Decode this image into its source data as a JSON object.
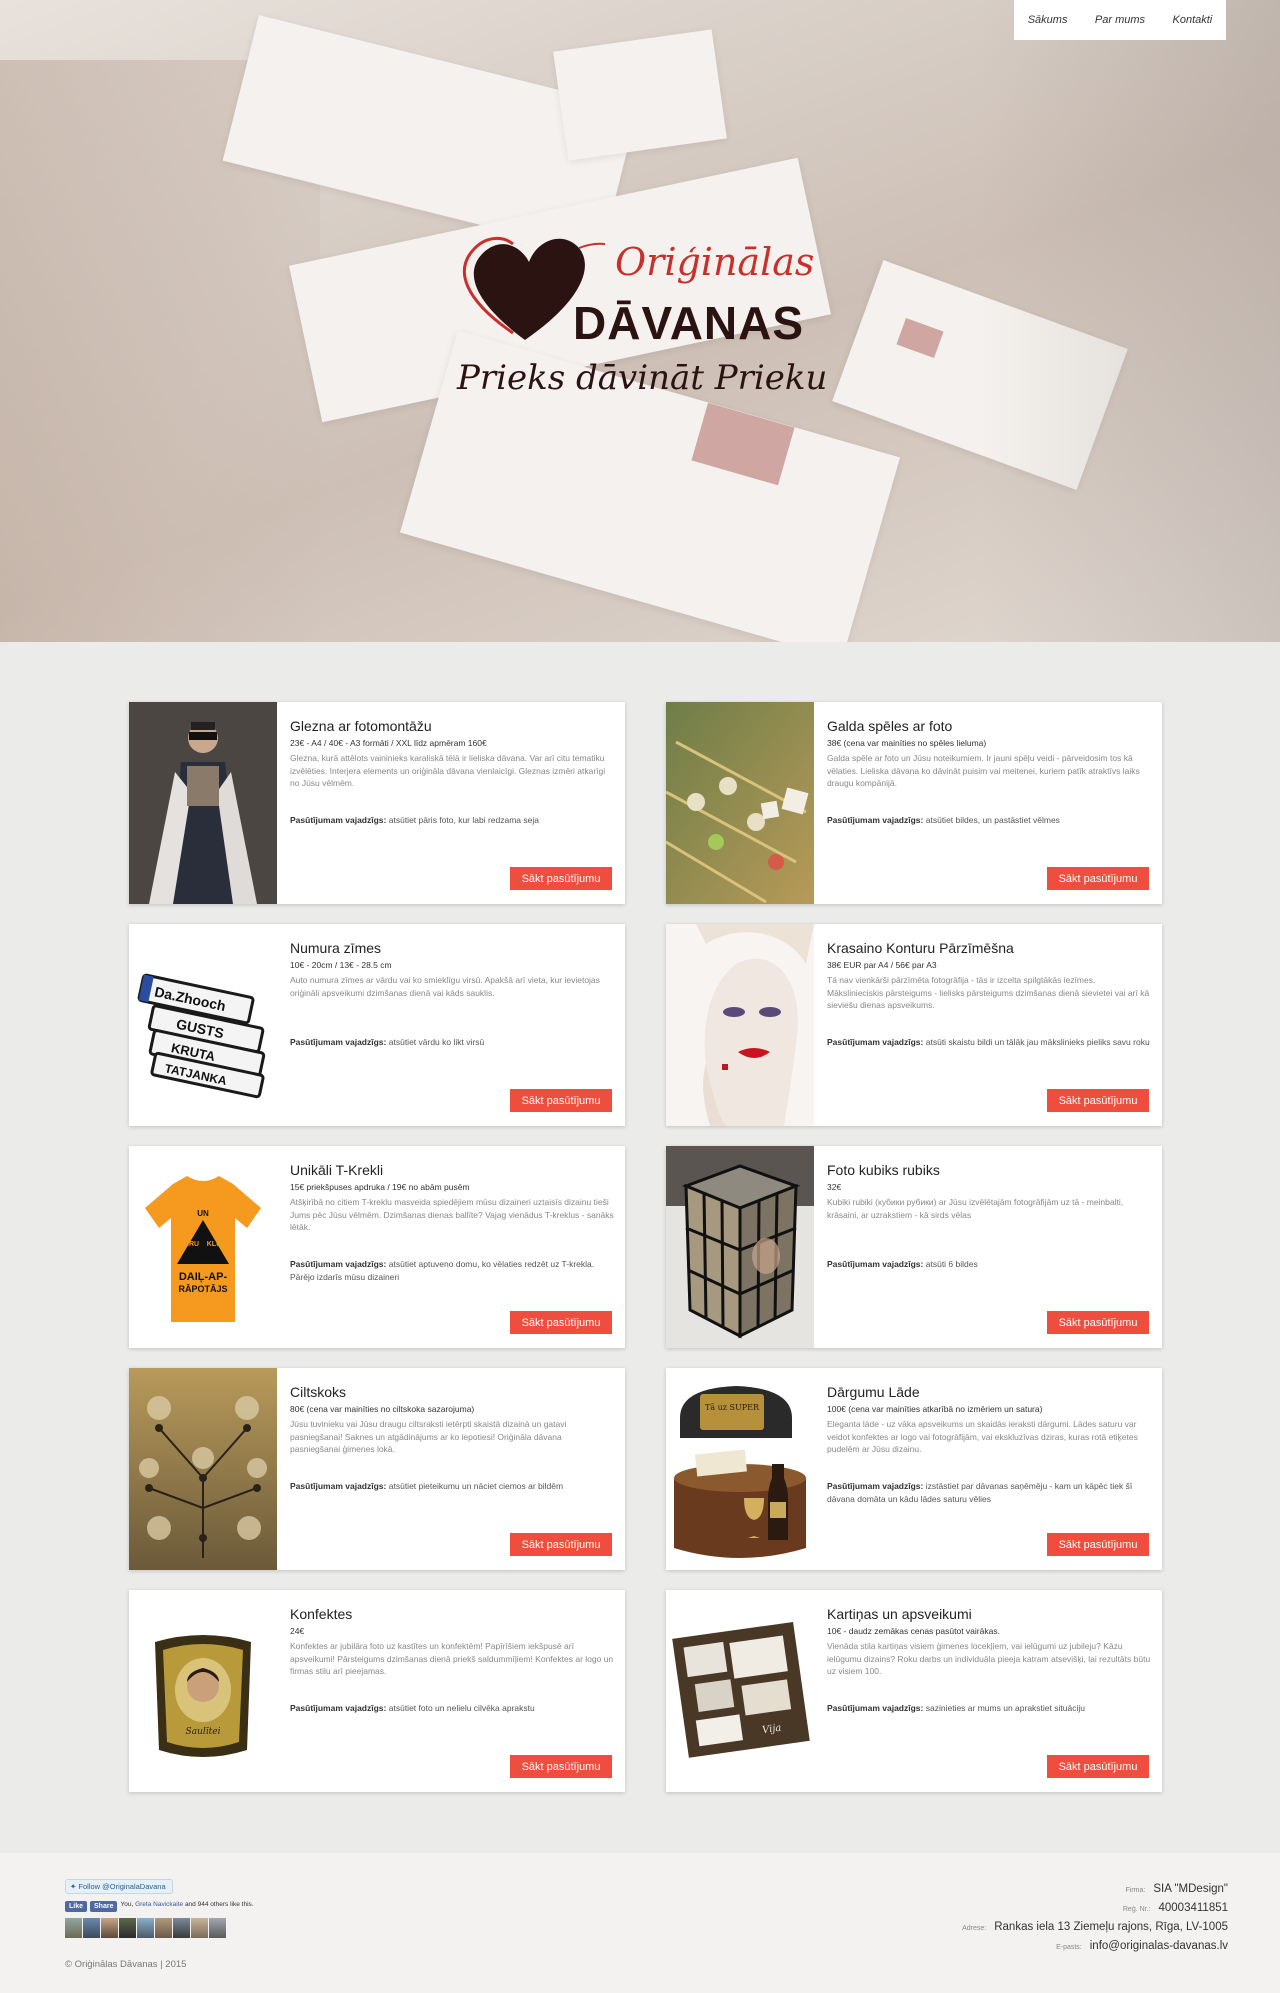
{
  "nav": {
    "items": [
      "Sākums",
      "Par mums",
      "Kontakti"
    ]
  },
  "logo": {
    "line1": "Oriģinālas",
    "line2": "DĀVANAS",
    "tagline": "Prieks dāvināt Prieku"
  },
  "products": [
    {
      "title": "Glezna ar fotomontāžu",
      "price": "23€ - A4 / 40€ - A3 formāti / XXL līdz apmēram 160€",
      "description": "Glezna, kurā attēlots vaininieks karaliskā tēlā ir lieliska dāvana. Var arī citu tematiku izvēlēties. Interjera elements un oriģināla dāvana vienlaicīgi. Gleznas izmēri atkarīgi no Jūsu vēlmēm.",
      "need_label": "Pasūtījumam vajadzīgs:",
      "need": "atsūtiet pāris foto, kur labi redzama seja",
      "button": "Sākt pasūtījumu",
      "image": "portrait-painting"
    },
    {
      "title": "Galda spēles ar foto",
      "price": "38€ (cena var mainīties no spēles lieluma)",
      "description": "Galda spēle ar foto un Jūsu noteikumiem. Ir jauni spēļu veidi - pārveidosim tos kā vēlaties. Lieliska dāvana ko dāvināt puisim vai meitenei, kuriem patīk atraktīvs laiks draugu kompānijā.",
      "need_label": "Pasūtījumam vajadzīgs:",
      "need": "atsūtiet bildes, un pastāstiet vēlmes",
      "button": "Sākt pasūtījumu",
      "image": "board-game"
    },
    {
      "title": "Numura zīmes",
      "price": "10€ - 20cm / 13€ - 28.5 cm",
      "description": "Auto numura zīmes ar vārdu vai ko smieklīgu virsū. Apakšā arī vieta, kur ievietojas oriģināli apsveikumi dzimšanas dienā vai kāds sauklis.",
      "need_label": "Pasūtījumam vajadzīgs:",
      "need": "atsūtiet vārdu ko likt virsū",
      "button": "Sākt pasūtījumu",
      "image": "license-plates",
      "plate_texts": [
        "Da.Zhooch",
        "GUSTS",
        "KRUTA",
        "TATJANKA"
      ]
    },
    {
      "title": "Krasaino Konturu Pārzīmēšna",
      "price": "38€ EUR par A4 / 56€ par A3",
      "description": "Tā nav vienkārši pārzīmēta fotogrāfija - tās ir izcelta spilgtākās iezīmes. Mākslinieciskis pārsteigums - lielisks pārsteigums dzimšanas dienā sievietei vai arī kā sieviešu dienas apsveikums.",
      "need_label": "Pasūtījumam vajadzīgs:",
      "need": "atsūti skaistu bildi un tālāk jau mākslinieks pieliks savu roku",
      "button": "Sākt pasūtījumu",
      "image": "color-portrait"
    },
    {
      "title": "Unikāli T-Krekli",
      "price": "15€ priekšpuses apdruka / 19€ no abām pusēm",
      "description": "Atšķirībā no citiem T-kreklu masveida spiedējiem mūsu dizaineri uztaisīs dizainu tieši Jums pēc Jūsu vēlmēm. Dzimšanas dienas ballīte? Vajag vienādus T-kreklus - sanāks lētāk.",
      "need_label": "Pasūtījumam vajadzīgs:",
      "need": "atsūtiet aptuveno domu, ko vēlaties redzēt uz T-krekla. Pārējo izdarīs mūsu dizaineri",
      "button": "Sākt pasūtījumu",
      "image": "t-shirt",
      "shirt_texts": [
        "UN",
        "BĀRU",
        "KLUBU",
        "DAIĻ-AP-",
        "RĀPOTĀJS"
      ]
    },
    {
      "title": "Foto kubiks rubiks",
      "price": "32€",
      "description": "Kubiki rubiki (кубики рубики) ar Jūsu izvēlētajām fotogrāfijām uz tā - meinbalti, krāsaini, ar uzrakstiem - kā sirds vēlas",
      "need_label": "Pasūtījumam vajadzīgs:",
      "need": "atsūti 6 bildes",
      "button": "Sākt pasūtījumu",
      "image": "photo-cube"
    },
    {
      "title": "Ciltskoks",
      "price": "80€ (cena var mainīties no ciltskoka sazarojuma)",
      "description": "Jūsu tuvinieku vai Jūsu draugu ciltsraksti ietērpti skaistā dizainā un gatavi pasniegšanai! Saknes un atgādinājums ar ko iepotiesi! Oriģināla dāvana pasniegšanai ģimenes lokā.",
      "need_label": "Pasūtījumam vajadzīgs:",
      "need": "atsūtiet pieteikumu un nāciet ciemos ar bildēm",
      "button": "Sākt pasūtījumu",
      "image": "family-tree"
    },
    {
      "title": "Dārgumu Lāde",
      "price": "100€ (cena var mainīties atkarībā no izmēriem un satura)",
      "description": "Eleganta lāde - uz vāka apsveikums un skaidās ieraksti dārgumi. Lādes saturu var veidot konfektes ar logo vai fotogrāfijām, vai ekskluzīvas dziras, kuras rotā etiķetes pudelēm ar Jūsu dizainu.",
      "need_label": "Pasūtījumam vajadzīgs:",
      "need": "izstāstiet par dāvanas saņēmēju - kam un kāpēc tiek šī dāvana domāta un kādu lādes saturu vēlies",
      "button": "Sākt pasūtījumu",
      "image": "treasure-chest",
      "chest_label": "Tā uz SUPER"
    },
    {
      "title": "Konfektes",
      "price": "24€",
      "description": "Konfektes ar jubilāra foto uz kastītes un konfektēm! Papīrīšiem iekšpusē arī apsveikumi! Pārsteigums dzimšanas dienā priekš saldummīļiem! Konfektes ar logo un firmas stilu arī pieejamas.",
      "need_label": "Pasūtījumam vajadzīgs:",
      "need": "atsūtiet foto un nelielu cilvēka aprakstu",
      "button": "Sākt pasūtījumu",
      "image": "candy-box",
      "box_label": "Saulītei"
    },
    {
      "title": "Kartiņas un apsveikumi",
      "price": "10€ - daudz zemākas cenas pasūtot vairākas.",
      "description": "Vienāda stila kartiņas visiem ģimenes locekļiem, vai ielūgumi uz jubileju? Kāzu ielūgumu dizains? Roku darbs un individuāla pieeja katram atsevišķi, lai rezultāts būtu uz visiem 100.",
      "need_label": "Pasūtījumam vajadzīgs:",
      "need": "sazinieties ar mums un aprakstiet situāciju",
      "button": "Sākt pasūtījumu",
      "image": "greeting-card",
      "card_label": "Vija"
    }
  ],
  "footer": {
    "twitter_follow": "Follow @OriginalaDavana",
    "fb_like": "Like",
    "fb_share": "Share",
    "fb_text_prefix": "You,",
    "fb_text_name": "Greta Navickaite",
    "fb_text_suffix": "and 944 others like this.",
    "copyright": "© Oriģinālas Dāvanas | 2015",
    "info": [
      {
        "label": "Firma:",
        "value": "SIA \"MDesign\""
      },
      {
        "label": "Reģ. Nr.:",
        "value": "40003411851"
      },
      {
        "label": "Adrese:",
        "value": "Rankas iela 13 Ziemeļu rajons, Rīga, LV-1005"
      },
      {
        "label": "E-pasts:",
        "value": "info@originalas-davanas.lv"
      }
    ]
  },
  "colors": {
    "accent": "#ef4e3e",
    "logo_red": "#c8302b",
    "logo_dark": "#2b1312",
    "page_bg": "#ebebea"
  }
}
